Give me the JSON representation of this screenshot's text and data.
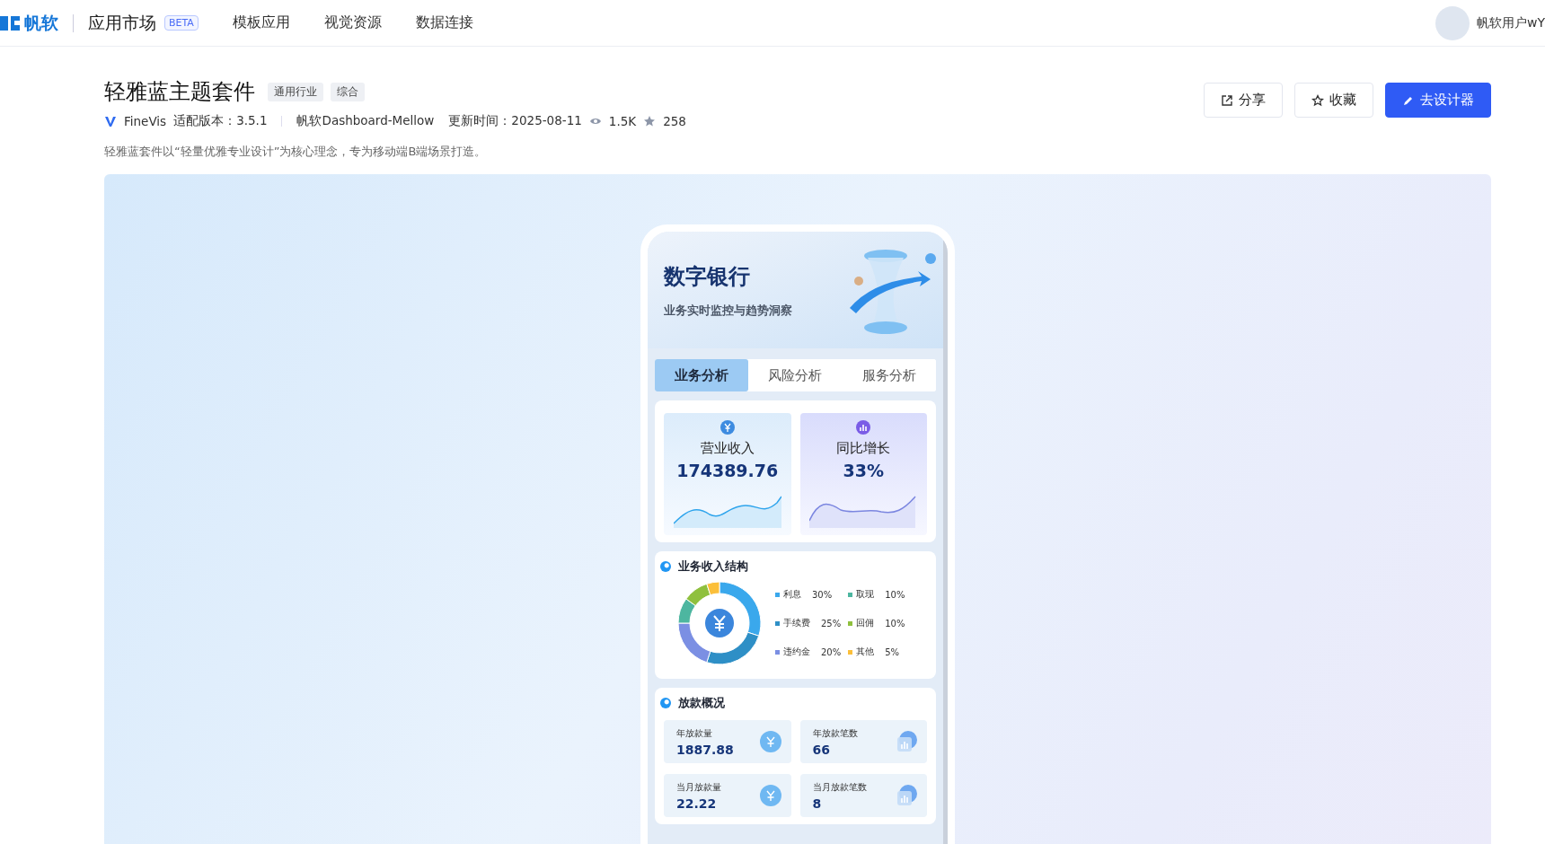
{
  "header": {
    "brand": "帆软",
    "app_title": "应用市场",
    "badge": "BETA",
    "nav": [
      "模板应用",
      "视觉资源",
      "数据连接"
    ],
    "user": "帆软用户wY"
  },
  "product": {
    "title": "轻雅蓝主题套件",
    "tags": [
      "通用行业",
      "综合"
    ],
    "platform": "FineVis",
    "version": "适配版本：3.5.1",
    "author": "帆软Dashboard-Mellow",
    "updated": "更新时间：2025-08-11",
    "views": "1.5K",
    "favorites": "258",
    "description": "轻雅蓝套件以“轻量优雅专业设计”为核心理念，专为移动端B端场景打造。"
  },
  "actions": [
    {
      "label": "分享",
      "kind": "share"
    },
    {
      "label": "收藏",
      "kind": "favorite"
    },
    {
      "label": "去设计器",
      "kind": "designer"
    }
  ],
  "preview": {
    "banner_title": "数字银行",
    "banner_subtitle": "业务实时监控与趋势洞察",
    "tabs": [
      {
        "label": "业务分析",
        "selected": true
      },
      {
        "label": "风险分析",
        "selected": false
      },
      {
        "label": "服务分析",
        "selected": false
      }
    ],
    "kpis": [
      {
        "label": "营业收入",
        "value": "174389.76",
        "kind": "revenue"
      },
      {
        "label": "同比增长",
        "value": "33%",
        "kind": "growth"
      }
    ],
    "income_structure": {
      "title": "业务收入结构",
      "chart_data": {
        "type": "donut",
        "categories": [
          "利息",
          "手续费",
          "违约金",
          "取现",
          "回佣",
          "其他"
        ],
        "values": [
          30,
          25,
          20,
          10,
          10,
          5
        ]
      },
      "legend": [
        {
          "value": "30%",
          "color": "#3aa8ec"
        },
        {
          "value": "25%",
          "color": "#2e8fc6"
        },
        {
          "value": "20%",
          "color": "#7b8fe3"
        },
        {
          "value": "10%",
          "color": "#4db6a0"
        },
        {
          "value": "10%",
          "color": "#8fc03e"
        },
        {
          "value": "5%",
          "color": "#fbbf3a"
        }
      ]
    },
    "loans": {
      "title": "放款概况",
      "items": [
        {
          "label": "年放款量",
          "value": "1887.88",
          "kind": "amount"
        },
        {
          "label": "年放款笔数",
          "value": "66",
          "kind": "count"
        },
        {
          "label": "当月放款量",
          "value": "22.22",
          "kind": "amount"
        },
        {
          "label": "当月放款笔数",
          "value": "8",
          "kind": "count"
        }
      ]
    }
  }
}
